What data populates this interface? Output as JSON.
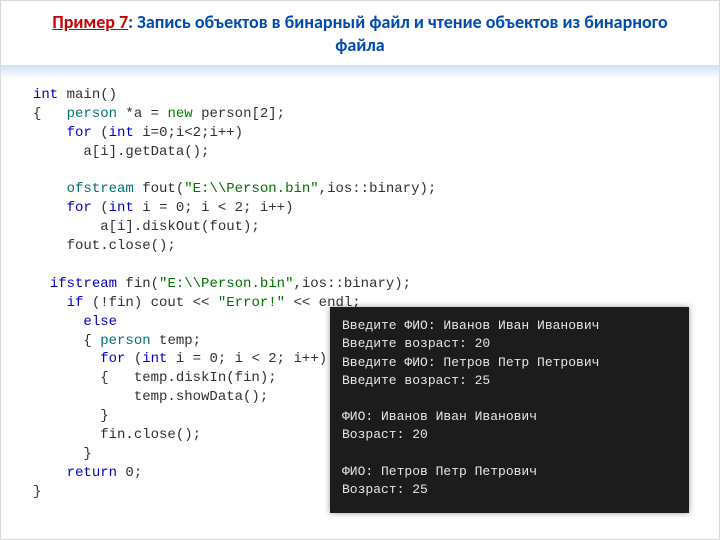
{
  "title": {
    "example": "Пример 7",
    "colon": ":",
    "rest": " Запись объектов в бинарный файл и чтение объектов из бинарного файла"
  },
  "code": {
    "l01a": "int",
    "l01b": " main()",
    "l02a": "{   ",
    "l02b": "person",
    "l02c": " *a = ",
    "l02d": "new",
    "l02e": " person[2];",
    "l03a": "    ",
    "l03b": "for",
    "l03c": " (",
    "l03d": "int",
    "l03e": " i=0;i<2;i++)",
    "l04": "      a[i].getData();",
    "blank1": "",
    "l05a": "    ",
    "l05b": "ofstream",
    "l05c": " fout(",
    "l05d": "\"E:\\\\Person.bin\"",
    "l05e": ",ios::binary);",
    "l06a": "    ",
    "l06b": "for",
    "l06c": " (",
    "l06d": "int",
    "l06e": " i = 0; i < 2; i++)",
    "l07": "        a[i].diskOut(fout);",
    "l08": "    fout.close();",
    "blank2": "",
    "l09a": "  ",
    "l09b": "ifstream",
    "l09c": " fin(",
    "l09d": "\"E:\\\\Person.bin\"",
    "l09e": ",ios::binary);",
    "l10a": "    ",
    "l10b": "if",
    "l10c": " (!fin) cout << ",
    "l10d": "\"Error!\"",
    "l10e": " << endl;",
    "l11a": "      ",
    "l11b": "else",
    "l12a": "      { ",
    "l12b": "person",
    "l12c": " temp;",
    "l13a": "        ",
    "l13b": "for",
    "l13c": " (",
    "l13d": "int",
    "l13e": " i = 0; i < 2; i++)",
    "l14": "        {   temp.diskIn(fin);",
    "l15": "            temp.showData();",
    "l16": "        }",
    "l17": "        fin.close();",
    "l18": "      }",
    "l19a": "    ",
    "l19b": "return",
    "l19c": " 0;",
    "l20": "}"
  },
  "console": {
    "l1": "Введите ФИО: Иванов Иван Иванович",
    "l2": "Введите возраст: 20",
    "l3": "Введите ФИО: Петров Петр Петрович",
    "l4": "Введите возраст: 25",
    "l5": "",
    "l6": "ФИО: Иванов Иван Иванович",
    "l7": "Возраст: 20",
    "l8": "",
    "l9": "ФИО: Петров Петр Петрович",
    "l10": "Возраст: 25"
  }
}
